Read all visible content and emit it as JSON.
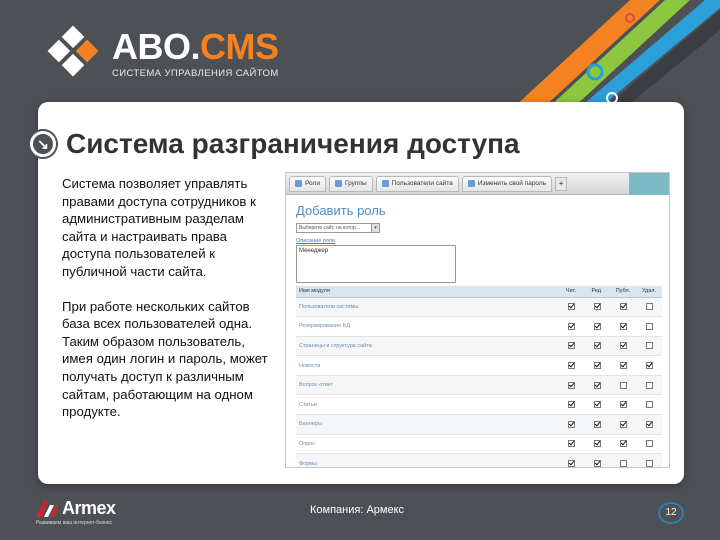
{
  "header": {
    "logo_title_main": "ABO.",
    "logo_title_accent": "CMS",
    "logo_subtitle": "СИСТЕМА УПРАВЛЕНИЯ САЙТОМ",
    "logo_mark_letter": "А"
  },
  "slide": {
    "title": "Система разграничения доступа",
    "paragraphs": [
      "Система позволяет управлять правами доступа сотрудников к административным разделам сайта и настраивать права доступа пользователей к публичной части сайта.",
      "При работе нескольких сайтов база всех пользователей одна. Таким образом пользователь, имея один логин и пароль, может получать доступ к различным сайтам, работающим на одном продукте."
    ]
  },
  "screenshot": {
    "tabs": [
      {
        "label": "Роли"
      },
      {
        "label": "Группы"
      },
      {
        "label": "Пользователи сайта"
      },
      {
        "label": "Изменить свой пароль"
      }
    ],
    "add_tab_label": "+",
    "heading": "Добавить роль",
    "site_select_value": "Выберите сайт, на котор...",
    "role_name_label": "Описание роли",
    "role_name_value": "Менеджер",
    "columns": [
      "Имя модуля",
      "Чит.",
      "Ред.",
      "Публ.",
      "Удал."
    ],
    "rows": [
      {
        "module": "Пользователи системы",
        "checks": [
          true,
          true,
          true,
          false
        ]
      },
      {
        "module": "Резервирование БД",
        "checks": [
          true,
          true,
          true,
          false
        ]
      },
      {
        "module": "Страницы и структура сайта",
        "checks": [
          true,
          true,
          true,
          false
        ]
      },
      {
        "module": "Новости",
        "checks": [
          true,
          true,
          true,
          true
        ]
      },
      {
        "module": "Вопрос-ответ",
        "checks": [
          true,
          true,
          false,
          false
        ]
      },
      {
        "module": "Статьи",
        "checks": [
          true,
          true,
          true,
          false
        ]
      },
      {
        "module": "Баннеры",
        "checks": [
          true,
          true,
          true,
          true
        ]
      },
      {
        "module": "Опрос",
        "checks": [
          true,
          true,
          true,
          false
        ]
      },
      {
        "module": "Формы",
        "checks": [
          true,
          true,
          false,
          false
        ]
      }
    ]
  },
  "footer": {
    "armex_name": "Armex",
    "armex_tagline": "Развиваем ваш интернет-бизнес",
    "company": "Компания: Армекс",
    "page_number": "12"
  },
  "colors": {
    "background": "#4d5155",
    "accent_orange": "#f58220",
    "accent_green": "#8dc63f",
    "accent_blue": "#2a7fb8",
    "armex_red": "#d2232a"
  }
}
